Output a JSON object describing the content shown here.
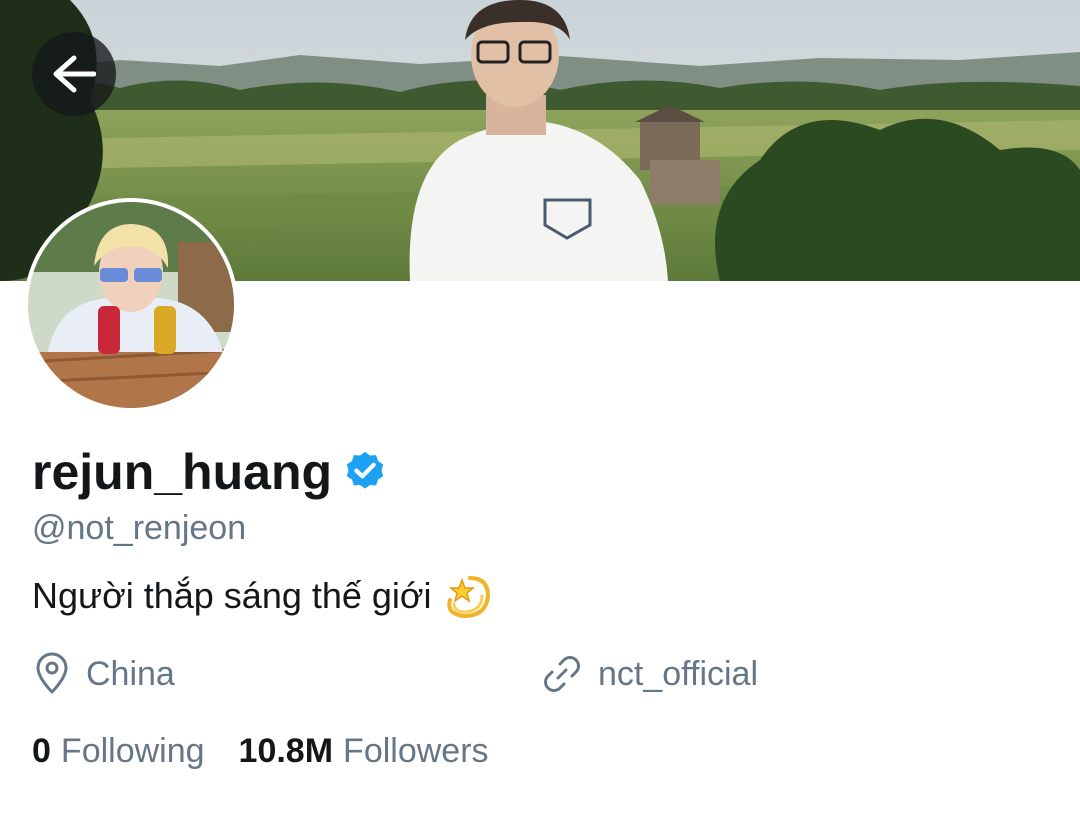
{
  "header": {
    "back_icon": "arrow-left-icon"
  },
  "profile": {
    "display_name": "rejun_huang",
    "verified": true,
    "handle": "@not_renjeon",
    "bio": "Người thắp sáng thế giới",
    "bio_emoji": "dizzy-star-emoji",
    "location": "China",
    "website": "nct_official"
  },
  "stats": {
    "following_count": "0",
    "following_label": "Following",
    "followers_count": "10.8M",
    "followers_label": "Followers"
  },
  "colors": {
    "verified_blue": "#1da1f2",
    "text_primary": "#14171a",
    "text_secondary": "#657786"
  }
}
